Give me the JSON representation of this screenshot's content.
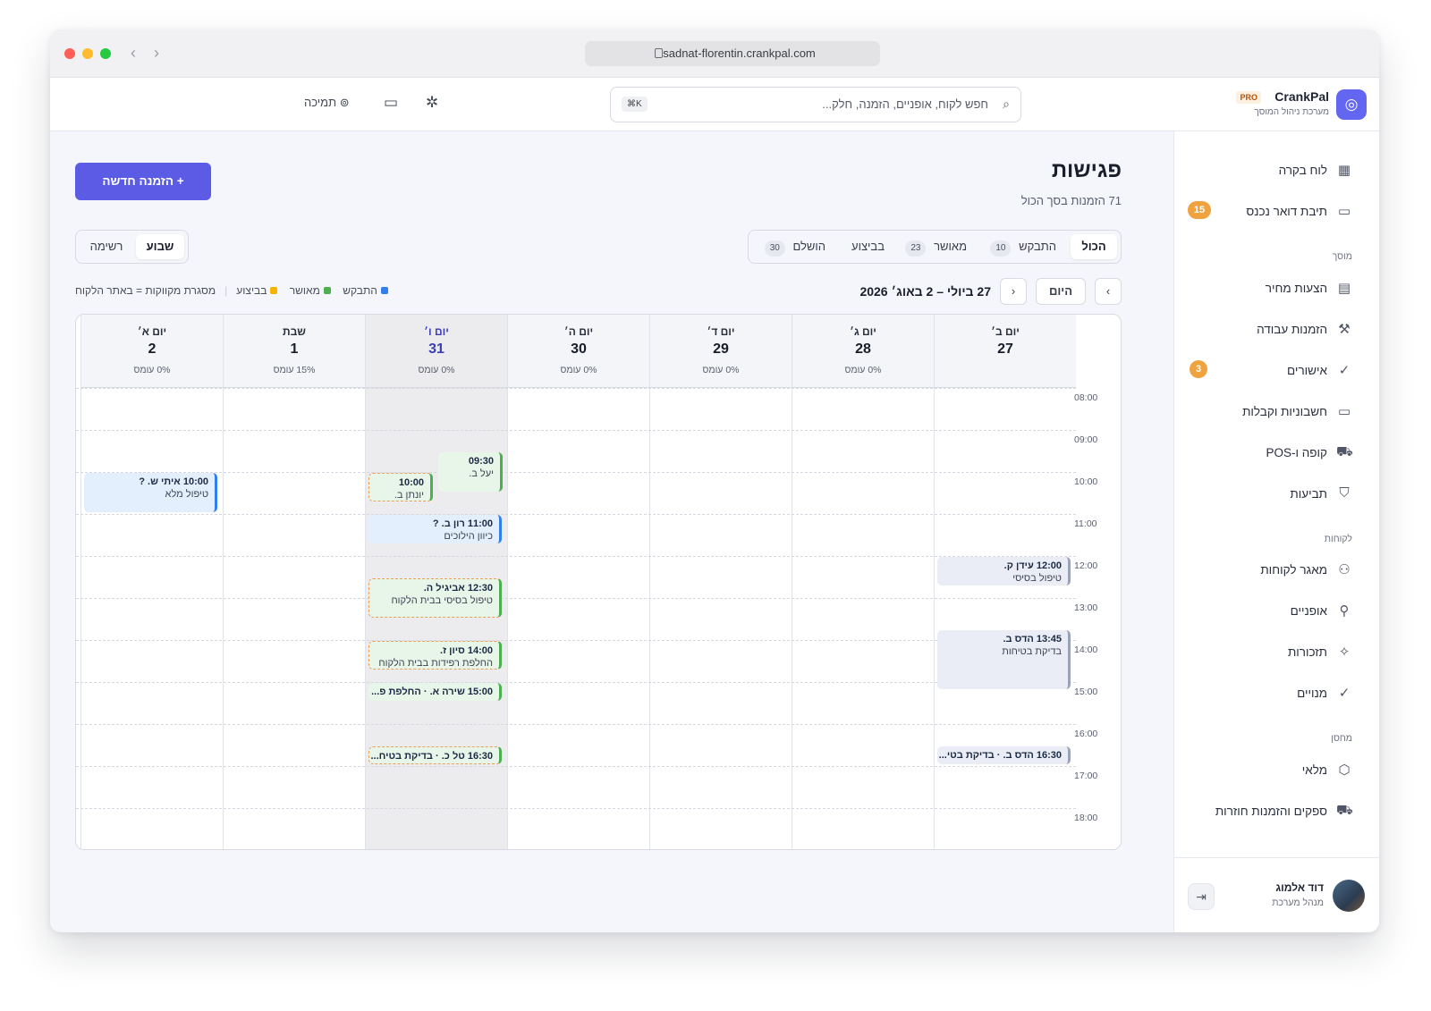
{
  "browser": {
    "url": "sadnat-florentin.crankpal.com"
  },
  "brand": {
    "name": "CrankPal",
    "tier": "PRO",
    "subtitle": "מערכת ניהול המוסך"
  },
  "topbar": {
    "search_placeholder": "חפש לקוח, אופניים, הזמנה, חלק...",
    "shortcut": "⌘K",
    "support_label": "תמיכה"
  },
  "sidebar": {
    "items": [
      {
        "label": "לוח בקרה",
        "icon": "dashboard-icon"
      },
      {
        "label": "תיבת דואר נכנס",
        "icon": "inbox-icon",
        "badge": "15"
      },
      {
        "label": "הצעות מחיר",
        "icon": "document-icon"
      },
      {
        "label": "הזמנות עבודה",
        "icon": "wrench-icon"
      },
      {
        "label": "אישורים",
        "icon": "check-circle-icon",
        "badge": "3"
      },
      {
        "label": "חשבוניות וקבלות",
        "icon": "cash-icon"
      },
      {
        "label": "קופה ו-POS",
        "icon": "cart-icon"
      },
      {
        "label": "תביעות",
        "icon": "shield-icon"
      },
      {
        "label": "מאגר לקוחות",
        "icon": "users-icon"
      },
      {
        "label": "אופניים",
        "icon": "bike-icon"
      },
      {
        "label": "תזכורות",
        "icon": "sparkle-icon"
      },
      {
        "label": "מנויים",
        "icon": "check-badge-icon"
      },
      {
        "label": "מלאי",
        "icon": "box-icon"
      },
      {
        "label": "ספקים והזמנות חוזרות",
        "icon": "truck-icon"
      }
    ],
    "sections": {
      "garage": "מוסך",
      "customers": "לקוחות",
      "warehouse": "מחסן"
    },
    "user": {
      "name": "דוד אלמוג",
      "role": "מנהל מערכת"
    }
  },
  "page": {
    "title": "פגישות",
    "subtitle": "71 הזמנות בסך הכול",
    "new_button": "+  הזמנה חדשה"
  },
  "filters": [
    {
      "label": "הכול"
    },
    {
      "label": "התבקש",
      "count": "10"
    },
    {
      "label": "מאושר",
      "count": "23"
    },
    {
      "label": "בביצוע"
    },
    {
      "label": "הושלם",
      "count": "30"
    }
  ],
  "view": {
    "week": "שבוע",
    "list": "רשימה"
  },
  "calendar_nav": {
    "today": "היום",
    "prev": "‹",
    "next": "›",
    "range": "27 ביולי – 2 באוג׳ 2026"
  },
  "legend": {
    "requested": "התבקש",
    "approved": "מאושר",
    "in_progress": "בביצוע",
    "note": "מסגרת מקווקות = באתר הלקוח"
  },
  "colors": {
    "requested": "#2f80ed",
    "approved": "#4caf50",
    "in_progress": "#f5b400",
    "accent": "#5b5be6"
  },
  "days": [
    {
      "name": "יום ב׳",
      "date": "27",
      "load": ""
    },
    {
      "name": "יום ג׳",
      "date": "28",
      "load": "0% עומס"
    },
    {
      "name": "יום ד׳",
      "date": "29",
      "load": "0% עומס"
    },
    {
      "name": "יום ה׳",
      "date": "30",
      "load": "0% עומס"
    },
    {
      "name": "יום ו׳",
      "date": "31",
      "load": "0% עומס"
    },
    {
      "name": "שבת",
      "date": "1",
      "load": "15% עומס"
    },
    {
      "name": "יום א׳",
      "date": "2",
      "load": "0% עומס"
    }
  ],
  "hours": [
    "08:00",
    "09:00",
    "10:00",
    "11:00",
    "12:00",
    "13:00",
    "14:00",
    "15:00",
    "16:00",
    "17:00",
    "18:00"
  ],
  "events": [
    {
      "day": 0,
      "start": "12:00",
      "title": "12:00 עידן ק.",
      "detail": "טיפול בסיסי",
      "status": "gray"
    },
    {
      "day": 0,
      "start": "13:45",
      "title": "13:45 הדס ב.",
      "detail": "בדיקת בטיחות",
      "status": "gray"
    },
    {
      "day": 0,
      "start": "16:30",
      "title": "16:30 הדס ב. · בדיקת בטי...",
      "detail": "",
      "status": "gray"
    },
    {
      "day": 4,
      "start": "09:30",
      "title": "09:30",
      "detail": "יעל ב.",
      "status": "green"
    },
    {
      "day": 4,
      "start": "10:00",
      "title": "10:00",
      "detail": "יונתן ב.",
      "status": "green-dash"
    },
    {
      "day": 4,
      "start": "11:00",
      "title": "11:00 רון ב. ?",
      "detail": "כיוון הילוכים",
      "status": "blue"
    },
    {
      "day": 4,
      "start": "12:30",
      "title": "12:30 אביגיל ה.",
      "detail": "טיפול בסיסי בבית הלקוח",
      "status": "green-dash"
    },
    {
      "day": 4,
      "start": "14:00",
      "title": "14:00 סיון ז.",
      "detail": "החלפת רפידות בבית הלקוח",
      "status": "green-dash"
    },
    {
      "day": 4,
      "start": "15:00",
      "title": "15:00 שירה א. · החלפת פ...",
      "detail": "",
      "status": "green"
    },
    {
      "day": 4,
      "start": "16:30",
      "title": "16:30 טל כ. · בדיקת בטיח...",
      "detail": "",
      "status": "green-dash"
    },
    {
      "day": 6,
      "start": "10:00",
      "title": "10:00 איתי ש. ?",
      "detail": "טיפול מלא",
      "status": "blue"
    }
  ]
}
